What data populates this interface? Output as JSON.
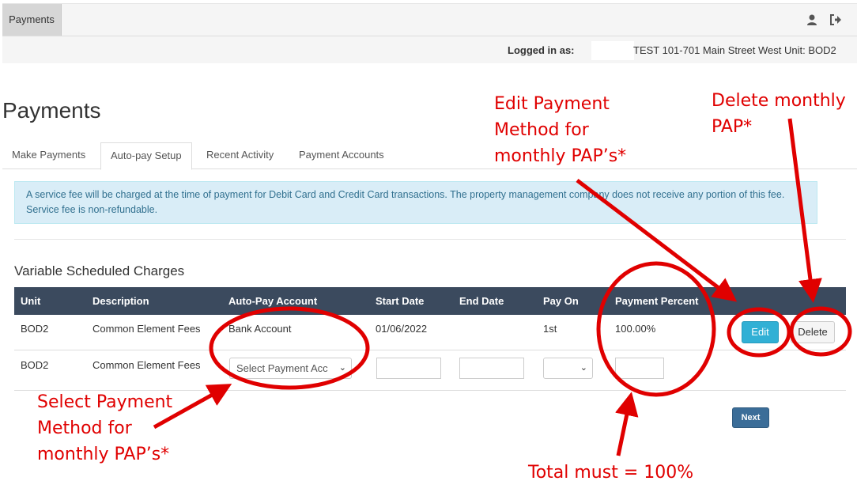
{
  "topbar": {
    "tab_label": "Payments",
    "icons": [
      "user-icon",
      "logout-icon"
    ]
  },
  "login": {
    "label": "Logged in as:",
    "value": "TEST 101-701 Main Street West Unit: BOD2"
  },
  "page": {
    "title": "Payments"
  },
  "tabs": [
    {
      "label": "Make Payments",
      "active": false
    },
    {
      "label": "Auto-pay Setup",
      "active": true
    },
    {
      "label": "Recent Activity",
      "active": false
    },
    {
      "label": "Payment Accounts",
      "active": false
    }
  ],
  "alert": {
    "text": "A service fee will be charged at the time of payment for Debit Card and Credit Card transactions. The property management company does not receive any portion of this fee. Service fee is non-refundable."
  },
  "section": {
    "title": "Variable Scheduled Charges"
  },
  "table": {
    "headers": [
      "Unit",
      "Description",
      "Auto-Pay Account",
      "Start Date",
      "End Date",
      "Pay On",
      "Payment Percent"
    ],
    "rows": [
      {
        "unit": "BOD2",
        "description": "Common Element Fees",
        "account": "Bank Account",
        "start_date": "01/06/2022",
        "end_date": "",
        "pay_on": "1st",
        "percent": "100.00%"
      },
      {
        "unit": "BOD2",
        "description": "Common Element Fees",
        "account_placeholder": "Select Payment Acc",
        "start_date": "",
        "end_date": "",
        "pay_on": "",
        "percent": ""
      }
    ],
    "edit_label": "Edit",
    "delete_label": "Delete"
  },
  "next_label": "Next",
  "annotations": {
    "edit_method": [
      "Edit Payment",
      "Method for",
      "monthly PAP’s*"
    ],
    "delete_pap": [
      "Delete monthly",
      "PAP*"
    ],
    "select_method": [
      "Select Payment",
      "Method for",
      "monthly PAP’s*"
    ],
    "total": "Total must = 100%",
    "color": "#e00000"
  },
  "colors": {
    "header_bg": "#3b4a5e",
    "alert_bg": "#d9edf7",
    "edit_btn": "#31b0d5",
    "next_btn": "#3b6d98"
  }
}
